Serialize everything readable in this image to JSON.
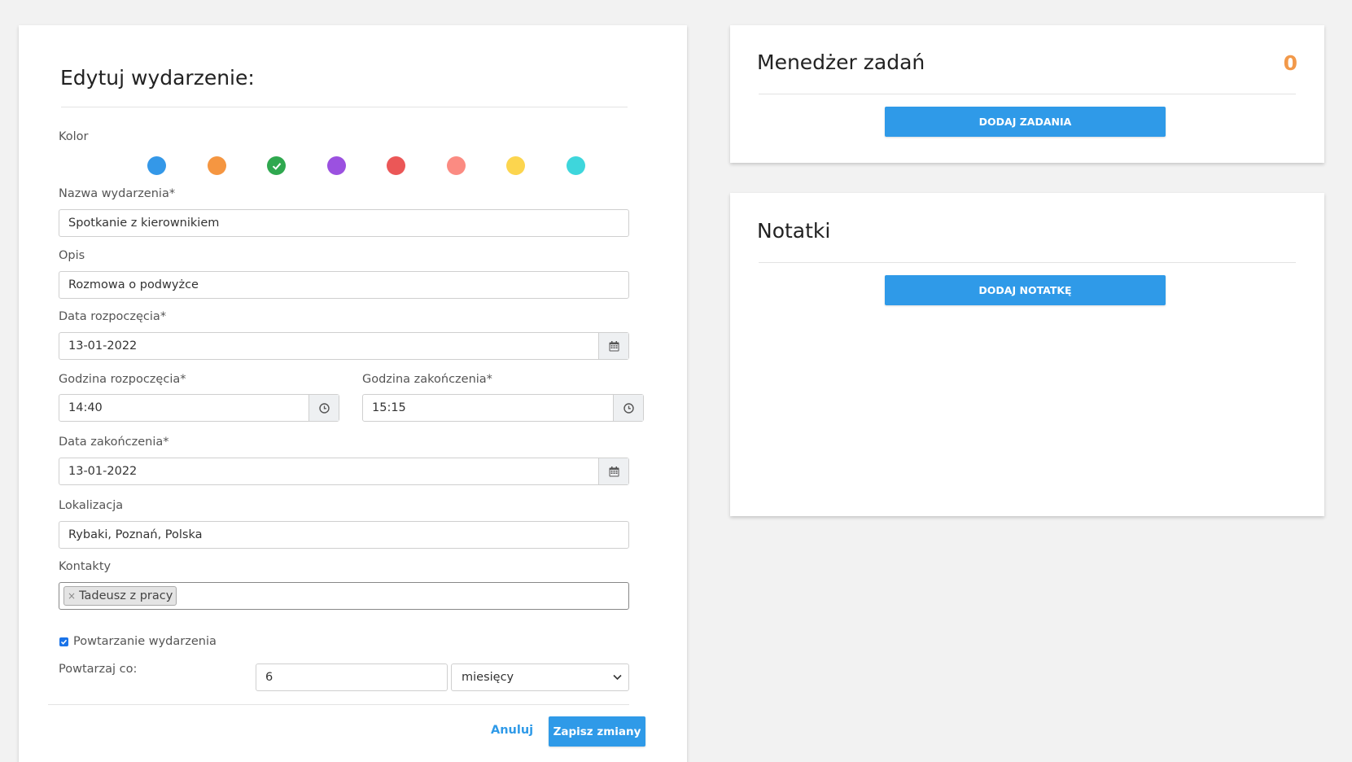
{
  "edit_form": {
    "title": "Edytuj wydarzenie:",
    "color_label": "Kolor",
    "colors": [
      "#3498e8",
      "#f59641",
      "#2fa84f",
      "#9b51e0",
      "#eb5757",
      "#fb8b82",
      "#fcd54e",
      "#3ed6dc"
    ],
    "selected_color_index": 2,
    "name_label": "Nazwa wydarzenia*",
    "name_value": "Spotkanie z kierownikiem",
    "description_label": "Opis",
    "description_value": "Rozmowa o podwyżce",
    "start_date_label": "Data rozpoczęcia*",
    "start_date_value": "13-01-2022",
    "start_time_label": "Godzina rozpoczęcia*",
    "start_time_value": "14:40",
    "end_time_label": "Godzina zakończenia*",
    "end_time_value": "15:15",
    "end_date_label": "Data zakończenia*",
    "end_date_value": "13-01-2022",
    "location_label": "Lokalizacja",
    "location_value": "Rybaki, Poznań, Polska",
    "contacts_label": "Kontakty",
    "contacts": [
      "Tadeusz z pracy"
    ],
    "repeat_label": "Powtarzanie wydarzenia",
    "repeat_checked": true,
    "repeat_every_label": "Powtarzaj co:",
    "repeat_every_value": "6",
    "repeat_unit": "miesięcy",
    "cancel_label": "Anuluj",
    "save_label": "Zapisz zmiany"
  },
  "tasks": {
    "title": "Menedżer zadań",
    "count": "0",
    "add_label": "DODAJ ZADANIA"
  },
  "notes": {
    "title": "Notatki",
    "add_label": "DODAJ NOTATKĘ"
  },
  "theme": {
    "primary": "#2f9ae8",
    "counter_color": "#f2994a"
  }
}
